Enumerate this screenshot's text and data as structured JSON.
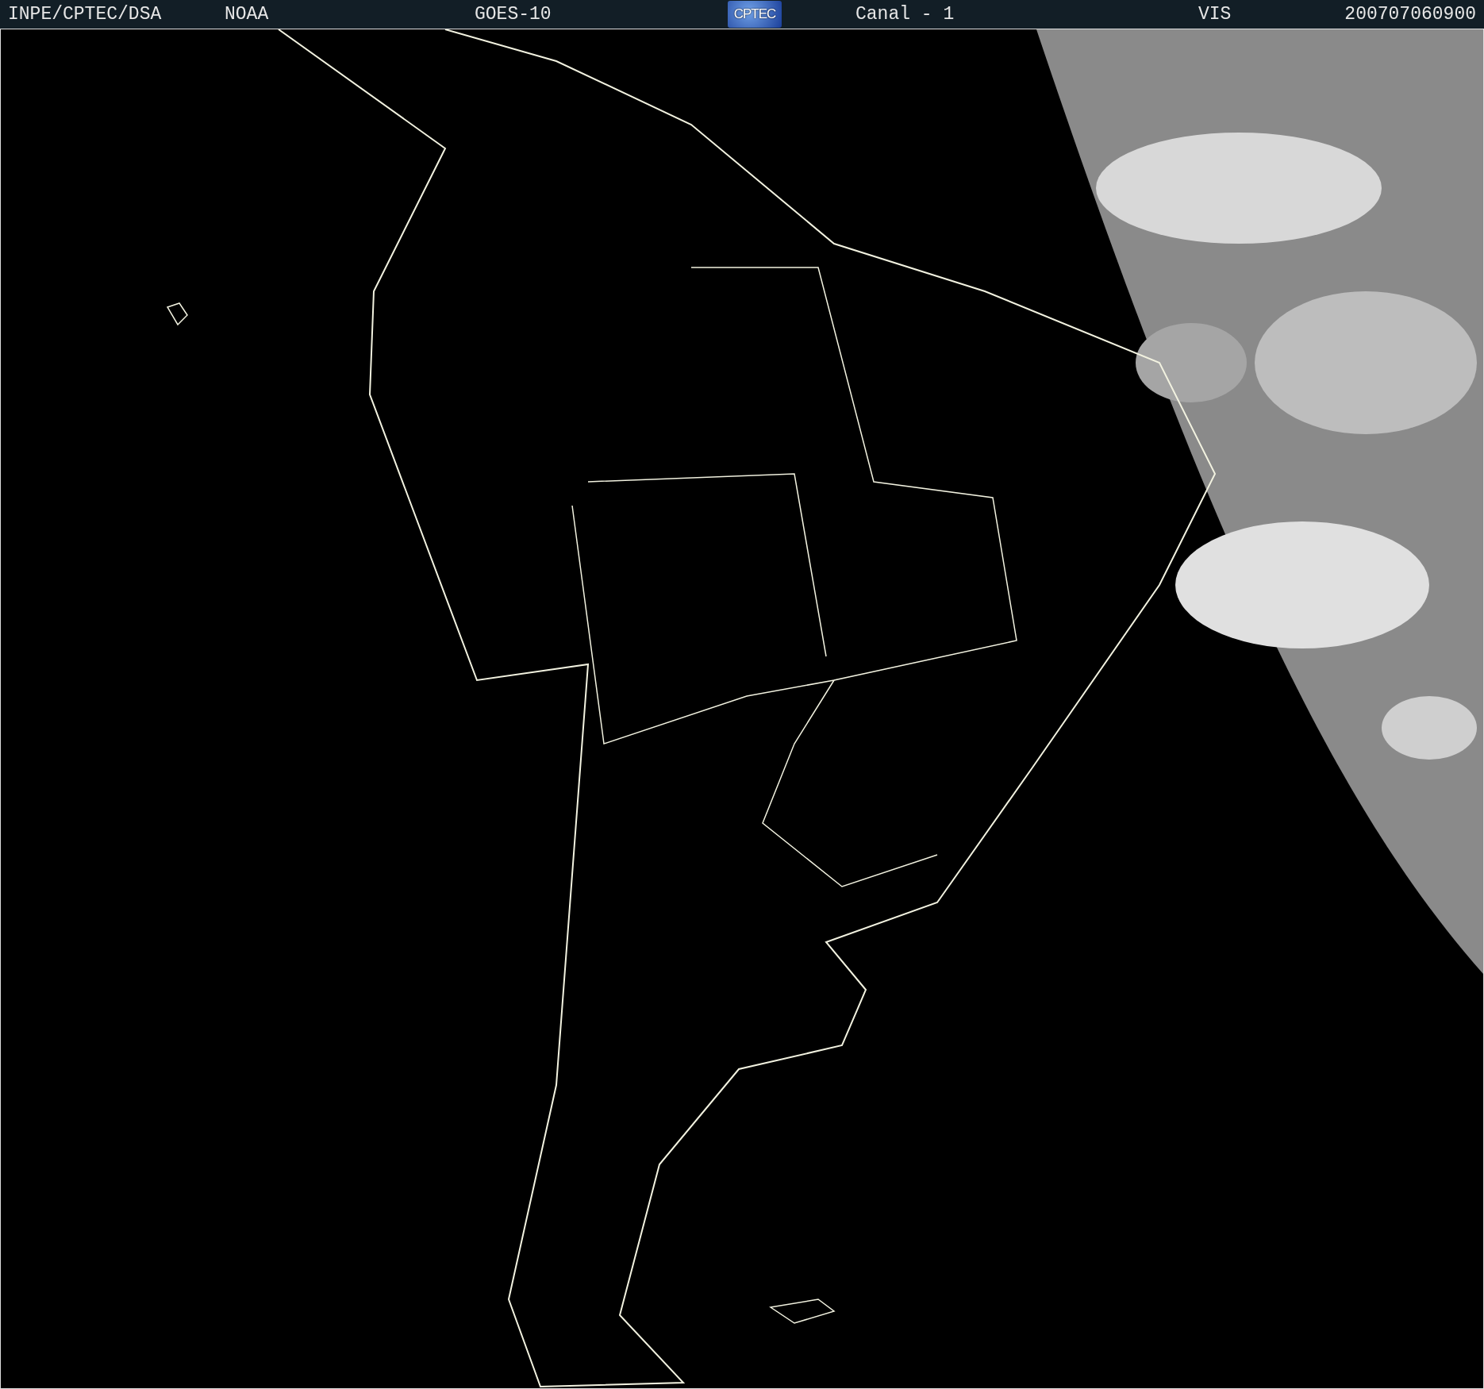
{
  "header": {
    "items": [
      {
        "text": "INPE/CPTEC/DSA"
      },
      {
        "text": "NOAA"
      },
      {
        "text": "GOES-10"
      },
      {
        "kind": "logo",
        "text": "CPTEC"
      },
      {
        "text": "Canal - 1"
      },
      {
        "text": "VIS"
      },
      {
        "text": "200707060900"
      }
    ]
  }
}
